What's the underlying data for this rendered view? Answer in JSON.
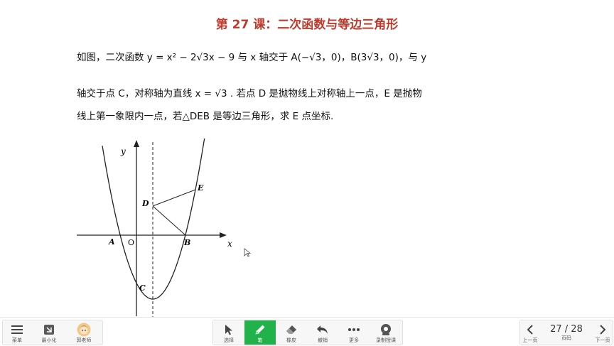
{
  "slide": {
    "title": "第 27 课：二次函数与等边三角形",
    "line1": "如图，二次函数 y = x² − 2√3x − 9 与 x 轴交于 A(−√3，0)，B(3√3，0)，与 y",
    "line2": "轴交于点 C，对称轴为直线 x = √3 . 若点 D 是抛物线上对称轴上一点，E 是抛物",
    "line3": "线上第一象限内一点，若△DEB 是等边三角形，求 E 点坐标."
  },
  "figure": {
    "labels": {
      "y": "y",
      "x": "x",
      "O": "O",
      "A": "A",
      "B": "B",
      "C": "C",
      "D": "D",
      "E": "E"
    }
  },
  "toolbar": {
    "menu_label": "菜单",
    "minimize_label": "最小化",
    "teacher_label": "郭老师",
    "select_label": "选择",
    "pen_label": "笔",
    "eraser_label": "橡皮",
    "undo_label": "撤销",
    "more_label": "更多",
    "record_label": "录制授课",
    "prev_label": "上一页",
    "page_label": "页码",
    "next_label": "下一页",
    "page_indicator": "27 / 28"
  },
  "icons": {
    "menu": "hamburger-icon",
    "minimize": "minimize-icon",
    "teacher": "avatar",
    "select": "cursor-icon",
    "pen": "pen-icon",
    "eraser": "eraser-icon",
    "undo": "undo-icon",
    "more": "more-dots-icon",
    "record": "record-icon",
    "prev": "chevron-left-icon",
    "next": "chevron-right-icon"
  },
  "colors": {
    "title": "#c0392b",
    "pen_active": "#21b24b"
  }
}
